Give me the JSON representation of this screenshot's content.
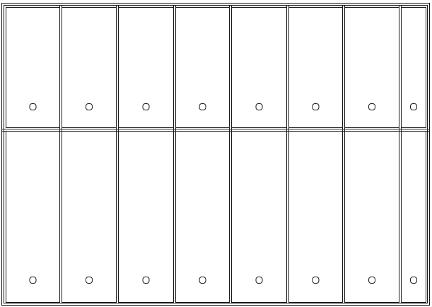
{
  "cabinet": {
    "rows": 2,
    "columns": 8,
    "line_color": "#1a1a1a",
    "fill_color": "#ffffff",
    "handle": "round-knob"
  }
}
